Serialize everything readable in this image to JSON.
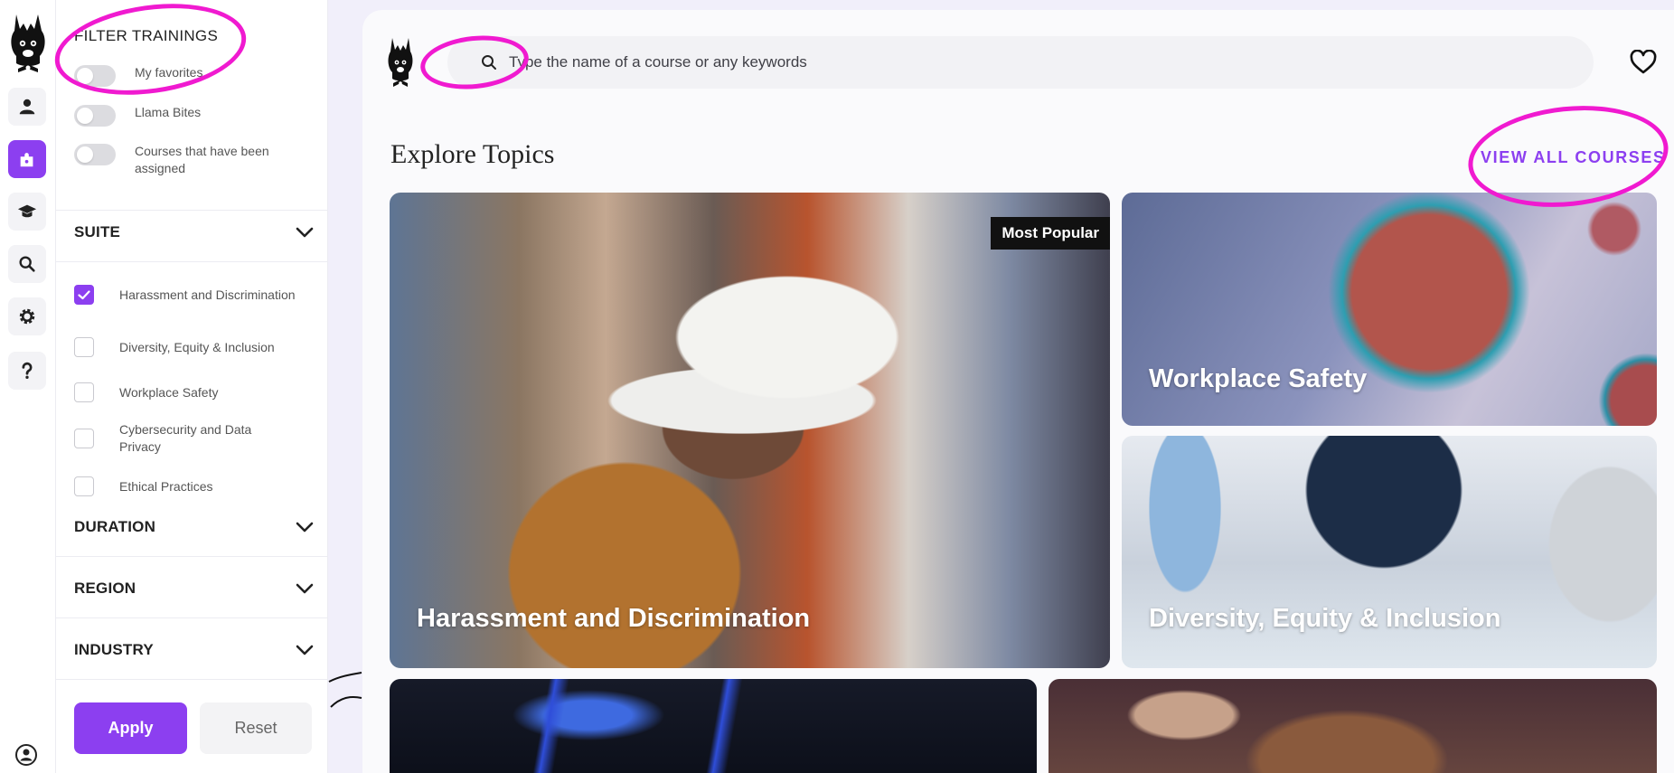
{
  "sidebar_rail": {
    "items": [
      {
        "icon": "user-icon",
        "active": false
      },
      {
        "icon": "puzzle-icon",
        "active": true
      },
      {
        "icon": "graduation-cap-icon",
        "active": false
      },
      {
        "icon": "search-icon",
        "active": false
      },
      {
        "icon": "gear-icon",
        "active": false
      },
      {
        "icon": "question-icon",
        "active": false
      }
    ],
    "bottom_icon": "account-circle-icon"
  },
  "filters": {
    "title": "FILTER TRAININGS",
    "toggles": [
      {
        "label": "My favorites",
        "on": false
      },
      {
        "label": "Llama Bites",
        "on": false
      },
      {
        "label": "Courses that have been assigned",
        "on": false
      }
    ],
    "suite": {
      "title": "SUITE",
      "options": [
        {
          "label": "Harassment and Discrimination",
          "checked": true
        },
        {
          "label": "Diversity, Equity & Inclusion",
          "checked": false
        },
        {
          "label": "Workplace Safety",
          "checked": false
        },
        {
          "label": "Cybersecurity and Data Privacy",
          "checked": false
        },
        {
          "label": "Ethical Practices",
          "checked": false
        }
      ]
    },
    "duration": {
      "title": "DURATION"
    },
    "region": {
      "title": "REGION"
    },
    "industry": {
      "title": "INDUSTRY"
    },
    "apply_label": "Apply",
    "reset_label": "Reset"
  },
  "search": {
    "placeholder": "Type the name of a course or any keywords",
    "value": ""
  },
  "main": {
    "section_title": "Explore Topics",
    "view_all_label": "VIEW ALL COURSES",
    "topics": [
      {
        "title": "Harassment and Discrimination",
        "badge": "Most Popular"
      },
      {
        "title": "Workplace Safety"
      },
      {
        "title": "Diversity, Equity & Inclusion"
      },
      {
        "title": ""
      },
      {
        "title": ""
      }
    ]
  },
  "colors": {
    "accent": "#8c3ff0",
    "annotation": "#f01ad0"
  }
}
